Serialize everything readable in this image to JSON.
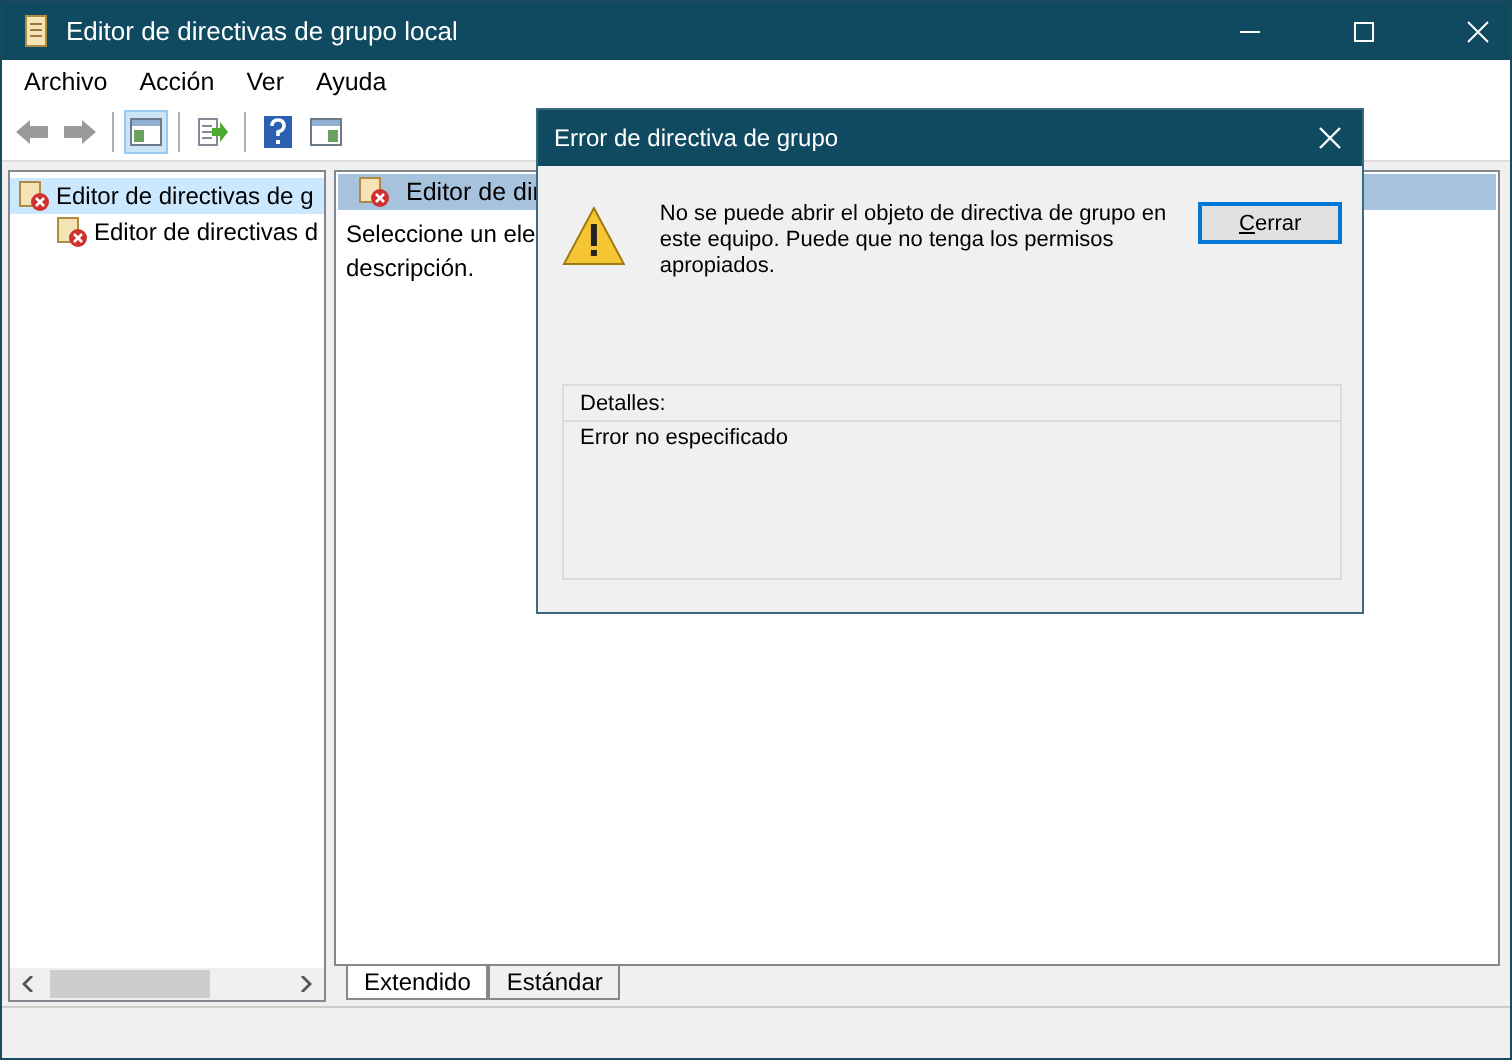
{
  "window": {
    "title": "Editor de directivas de grupo local"
  },
  "menu": [
    "Archivo",
    "Acción",
    "Ver",
    "Ayuda"
  ],
  "toolbar": [
    {
      "kind": "back",
      "pressed": false
    },
    {
      "kind": "forward",
      "pressed": false
    },
    {
      "kind": "tree-toggle",
      "pressed": true
    },
    {
      "kind": "export",
      "pressed": false
    },
    {
      "kind": "help",
      "pressed": false
    },
    {
      "kind": "action-pane",
      "pressed": false
    }
  ],
  "tree": [
    {
      "label": "Editor de directivas de g",
      "selected": true,
      "children": [
        {
          "label": "Editor de directivas d",
          "selected": false
        }
      ]
    }
  ],
  "details_pane": {
    "header": "Editor de dir",
    "text_lines": [
      "Seleccione un ele",
      "descripción."
    ]
  },
  "view_tabs": [
    {
      "label": "Extendido",
      "selected": true
    },
    {
      "label": "Estándar",
      "selected": false
    }
  ],
  "dialog": {
    "title": "Error de directiva de grupo",
    "message": "No se puede abrir el objeto de directiva de grupo en este equipo. Puede que no tenga los permisos apropiados.",
    "button": "Cerrar",
    "details_label": "Detalles:",
    "details_text": "Error no especificado"
  }
}
